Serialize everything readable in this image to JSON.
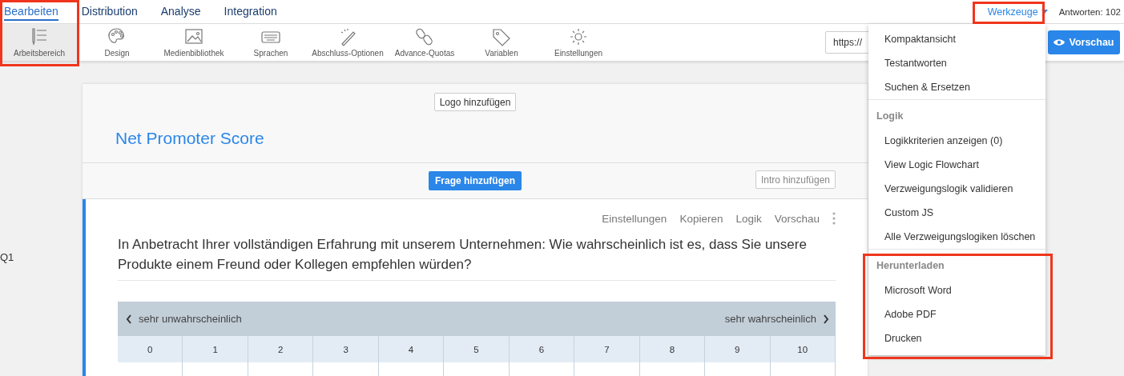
{
  "tabs": [
    {
      "label": "Bearbeiten",
      "selected": true
    },
    {
      "label": "Distribution",
      "selected": false
    },
    {
      "label": "Analyse",
      "selected": false
    },
    {
      "label": "Integration",
      "selected": false
    }
  ],
  "tools_menu": {
    "label": "Werkzeuge",
    "expanded": true
  },
  "responses": "Antworten: 102",
  "toolbar": [
    {
      "label": "Arbeitsbereich",
      "kind": "workspace",
      "selected": true
    },
    {
      "label": "Design",
      "kind": "palette",
      "selected": false
    },
    {
      "label": "Medienbibliothek",
      "kind": "image",
      "selected": false
    },
    {
      "label": "Sprachen",
      "kind": "keyboard",
      "selected": false
    },
    {
      "label": "Abschluss-Optionen",
      "kind": "wand",
      "selected": false
    },
    {
      "label": "Advance-Quotas",
      "kind": "link",
      "selected": false
    },
    {
      "label": "Variablen",
      "kind": "tag",
      "selected": false
    },
    {
      "label": "Einstellungen",
      "kind": "gear",
      "selected": false
    }
  ],
  "url_field": {
    "value": "https://"
  },
  "preview_button": "Vorschau",
  "survey": {
    "logo_button": "Logo hinzufügen",
    "title": "Net Promoter Score",
    "add_question": "Frage hinzufügen",
    "add_intro": "Intro hinzufügen"
  },
  "question": {
    "number": "Q1",
    "actions": [
      "Einstellungen",
      "Kopieren",
      "Logik",
      "Vorschau"
    ],
    "text": "In Anbetracht Ihrer vollständigen Erfahrung mit unserem Unternehmen: Wie wahrscheinlich ist es, dass Sie unsere Produkte einem Freund oder Kollegen empfehlen würden?",
    "low_label": "sehr unwahrscheinlich",
    "high_label": "sehr wahrscheinlich",
    "scale": [
      "0",
      "1",
      "2",
      "3",
      "4",
      "5",
      "6",
      "7",
      "8",
      "9",
      "10"
    ]
  },
  "dropdown": [
    {
      "kind": "item",
      "label": "Kompaktansicht"
    },
    {
      "kind": "item",
      "label": "Testantworten"
    },
    {
      "kind": "item",
      "label": "Suchen & Ersetzen"
    },
    {
      "kind": "header",
      "label": "Logik"
    },
    {
      "kind": "item",
      "label": "Logikkriterien anzeigen (0)"
    },
    {
      "kind": "item",
      "label": "View Logic Flowchart"
    },
    {
      "kind": "item",
      "label": "Verzweigungslogik validieren"
    },
    {
      "kind": "item",
      "label": "Custom JS"
    },
    {
      "kind": "item",
      "label": "Alle Verzweigungslogiken löschen"
    },
    {
      "kind": "header",
      "label": "Herunterladen"
    },
    {
      "kind": "item",
      "label": "Microsoft Word"
    },
    {
      "kind": "item",
      "label": "Adobe PDF"
    },
    {
      "kind": "item",
      "label": "Drucken"
    }
  ],
  "highlight_frames": {
    "edit": true,
    "tools": true,
    "download": true
  }
}
